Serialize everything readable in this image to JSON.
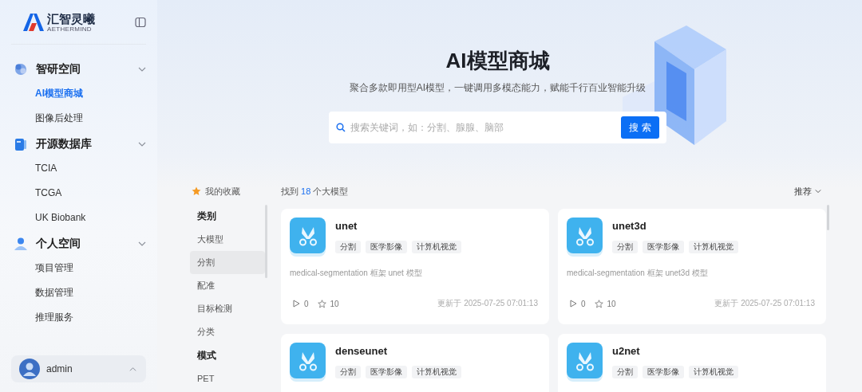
{
  "brand": {
    "name": "汇智灵曦",
    "tagline": "AETHERMIND"
  },
  "sidebar": {
    "groups": [
      {
        "label": "智研空间",
        "expanded": true,
        "children": [
          {
            "label": "AI模型商城",
            "selected": true
          },
          {
            "label": "图像后处理",
            "selected": false
          }
        ]
      },
      {
        "label": "开源数据库",
        "expanded": true,
        "children": [
          {
            "label": "TCIA",
            "selected": false
          },
          {
            "label": "TCGA",
            "selected": false
          },
          {
            "label": "UK Biobank",
            "selected": false
          }
        ]
      },
      {
        "label": "个人空间",
        "expanded": true,
        "children": [
          {
            "label": "项目管理",
            "selected": false
          },
          {
            "label": "数据管理",
            "selected": false
          },
          {
            "label": "推理服务",
            "selected": false
          }
        ]
      }
    ],
    "user": {
      "name": "admin"
    }
  },
  "hero": {
    "title": "AI模型商城",
    "subtitle": "聚合多款即用型AI模型，一键调用多模态能力，赋能千行百业智能升级",
    "search": {
      "placeholder": "搜索关键词，如：分割、腺腺、脑部",
      "button": "搜 索"
    }
  },
  "filters": {
    "favorites": "我的收藏",
    "sections": [
      {
        "title": "类别",
        "items": [
          {
            "label": "大模型",
            "selected": false
          },
          {
            "label": "分割",
            "selected": true
          },
          {
            "label": "配准",
            "selected": false
          },
          {
            "label": "目标检测",
            "selected": false
          },
          {
            "label": "分类",
            "selected": false
          }
        ]
      },
      {
        "title": "模式",
        "items": [
          {
            "label": "PET",
            "selected": false
          }
        ]
      }
    ]
  },
  "results": {
    "prefix": "找到",
    "count": "18",
    "suffix": "个大模型",
    "sort": "推荐"
  },
  "cards": [
    {
      "name": "unet",
      "tags": [
        "分割",
        "医学影像",
        "计算机视觉"
      ],
      "description": "medical-segmentation 框架 unet 模型",
      "runs": "0",
      "stars": "10",
      "updated": "更新于 2025-07-25 07:01:13"
    },
    {
      "name": "unet3d",
      "tags": [
        "分割",
        "医学影像",
        "计算机视觉"
      ],
      "description": "medical-segmentation 框架 unet3d 模型",
      "runs": "0",
      "stars": "10",
      "updated": "更新于 2025-07-25 07:01:13"
    },
    {
      "name": "denseunet",
      "tags": [
        "分割",
        "医学影像",
        "计算机视觉"
      ]
    },
    {
      "name": "u2net",
      "tags": [
        "分割",
        "医学影像",
        "计算机视觉"
      ]
    }
  ]
}
